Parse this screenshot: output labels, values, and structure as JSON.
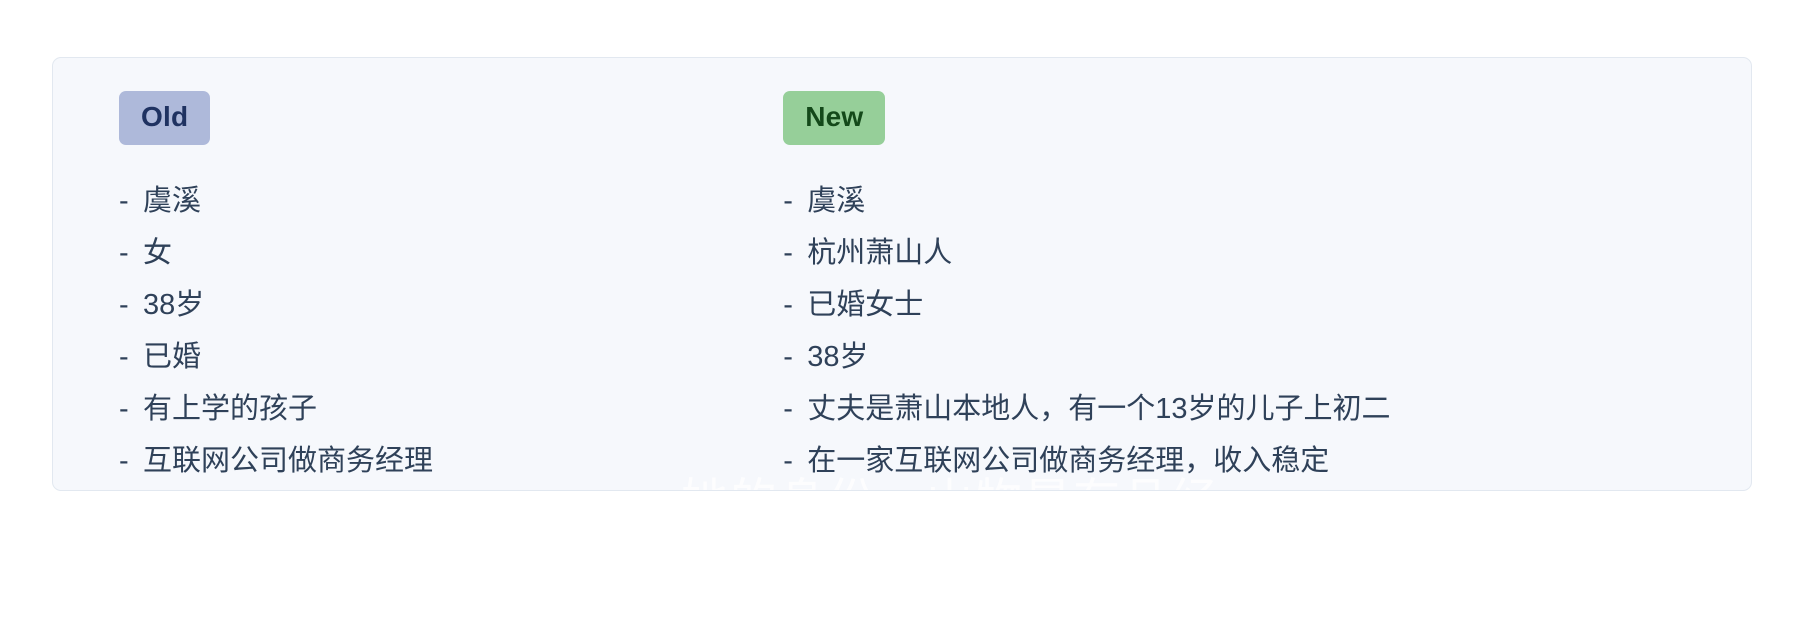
{
  "card": {
    "background_color": "#f6f8fc",
    "border_color": "#e2e8f0"
  },
  "columns": [
    {
      "badge_label": "Old",
      "badge_background": "#aeb9da",
      "badge_text_color": "#1f3261",
      "bullet": "-",
      "items": [
        "虞溪",
        "女",
        "38岁",
        "已婚",
        "有上学的孩子",
        "互联网公司做商务经理"
      ]
    },
    {
      "badge_label": "New",
      "badge_background": "#96cf99",
      "badge_text_color": "#14491a",
      "bullet": "-",
      "items": [
        "虞溪",
        "杭州萧山人",
        "已婚女士",
        "38岁",
        "丈夫是萧山本地人，有一个13岁的儿子上初二",
        "在一家互联网公司做商务经理，收入稳定"
      ]
    }
  ],
  "watermark": {
    "text": "她的身份、山物是有品经",
    "color": "#ffffff"
  }
}
